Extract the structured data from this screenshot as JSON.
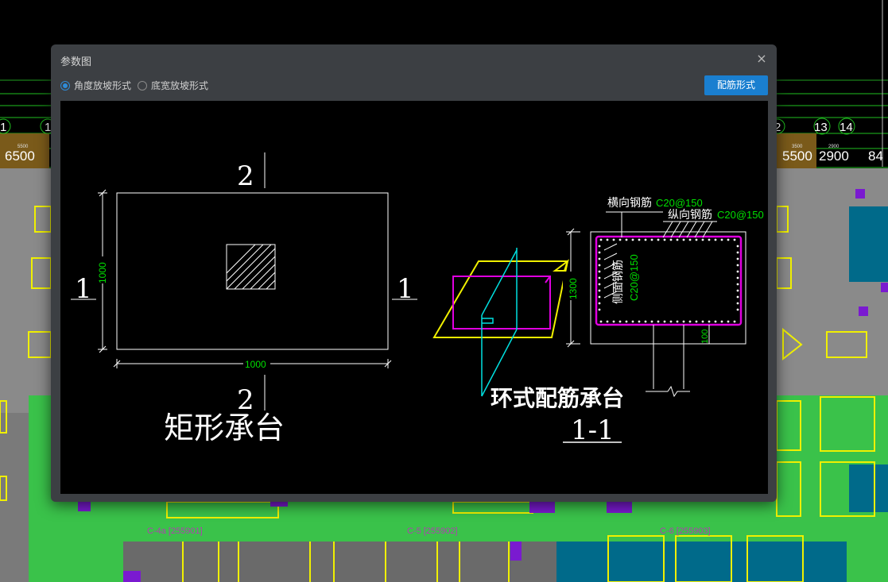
{
  "background": {
    "grid_numbers": [
      "1",
      "1",
      "2",
      "13",
      "14"
    ],
    "dims": [
      "6500",
      "5500",
      "2900",
      "84"
    ],
    "dims_small": [
      "5500",
      "3500",
      "2900"
    ],
    "bottom_labels": [
      "C-4a [255901]",
      "C-5 [255902]",
      "C-6 [255903]"
    ]
  },
  "dialog": {
    "title": "参数图",
    "close": "×",
    "radio_angle": "角度放坡形式",
    "radio_width": "底宽放坡形式",
    "button": "配筋形式"
  },
  "drawing": {
    "sec_top": "2",
    "sec_bottom": "2",
    "sec_left": "1",
    "sec_right": "1",
    "dim_vertical": "1000",
    "dim_horizontal": "1000",
    "title_rect": "矩形承台",
    "label_trans": "横向钢筋",
    "label_trans_spec": "C20@150",
    "label_long": "纵向钢筋",
    "label_long_spec": "C20@150",
    "label_side": "侧面钢筋",
    "label_side_spec": "C20@150",
    "dim_height": "1300",
    "dim_bottom": "100",
    "title_ring": "环式配筋承台",
    "title_section": "1-1"
  },
  "colors": {
    "accent": "#1a7fd0",
    "cad_green": "#00e000",
    "cad_magenta": "#e000e0",
    "cad_yellow": "#f0f000",
    "cad_cyan": "#00e0e0"
  }
}
